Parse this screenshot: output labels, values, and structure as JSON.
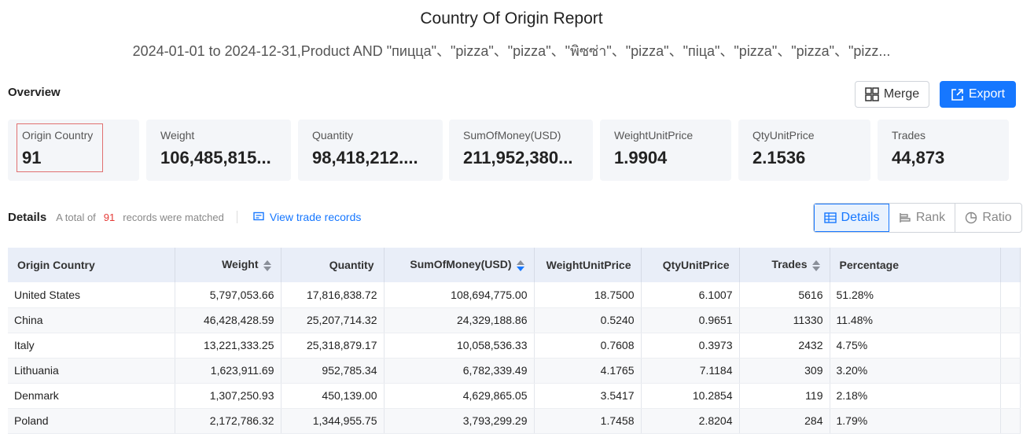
{
  "report": {
    "title": "Country Of Origin Report",
    "subtitle": "2024-01-01 to 2024-12-31,Product AND \"пицца\"、\"pizza\"、\"pizza\"、\"พิซซ่า\"、\"pizza\"、\"піца\"、\"pizza\"、\"pizza\"、\"pizz..."
  },
  "overview": {
    "label": "Overview",
    "merge_label": "Merge",
    "export_label": "Export",
    "cards": [
      {
        "label": "Origin Country",
        "value": "91"
      },
      {
        "label": "Weight",
        "value": "106,485,815..."
      },
      {
        "label": "Quantity",
        "value": "98,418,212...."
      },
      {
        "label": "SumOfMoney(USD)",
        "value": "211,952,380..."
      },
      {
        "label": "WeightUnitPrice",
        "value": "1.9904"
      },
      {
        "label": "QtyUnitPrice",
        "value": "2.1536"
      },
      {
        "label": "Trades",
        "value": "44,873"
      }
    ]
  },
  "details": {
    "title": "Details",
    "total_prefix": "A total of",
    "total_count": "91",
    "total_suffix": "records were matched",
    "view_link": "View trade records",
    "views": {
      "details": "Details",
      "rank": "Rank",
      "ratio": "Ratio"
    }
  },
  "table": {
    "headers": [
      "Origin Country",
      "Weight",
      "Quantity",
      "SumOfMoney(USD)",
      "WeightUnitPrice",
      "QtyUnitPrice",
      "Trades",
      "Percentage"
    ],
    "rows": [
      [
        "United States",
        "5,797,053.66",
        "17,816,838.72",
        "108,694,775.00",
        "18.7500",
        "6.1007",
        "5616",
        "51.28%"
      ],
      [
        "China",
        "46,428,428.59",
        "25,207,714.32",
        "24,329,188.86",
        "0.5240",
        "0.9651",
        "11330",
        "11.48%"
      ],
      [
        "Italy",
        "13,221,333.25",
        "25,318,879.17",
        "10,058,536.33",
        "0.7608",
        "0.3973",
        "2432",
        "4.75%"
      ],
      [
        "Lithuania",
        "1,623,911.69",
        "952,785.34",
        "6,782,339.49",
        "4.1765",
        "7.1184",
        "309",
        "3.20%"
      ],
      [
        "Denmark",
        "1,307,250.93",
        "450,139.00",
        "4,629,865.05",
        "3.5417",
        "10.2854",
        "119",
        "2.18%"
      ],
      [
        "Poland",
        "2,172,786.32",
        "1,344,955.75",
        "3,793,299.29",
        "1.7458",
        "2.8204",
        "284",
        "1.79%"
      ]
    ]
  },
  "colors": {
    "accent": "#1677ff",
    "highlight": "#e53935"
  }
}
